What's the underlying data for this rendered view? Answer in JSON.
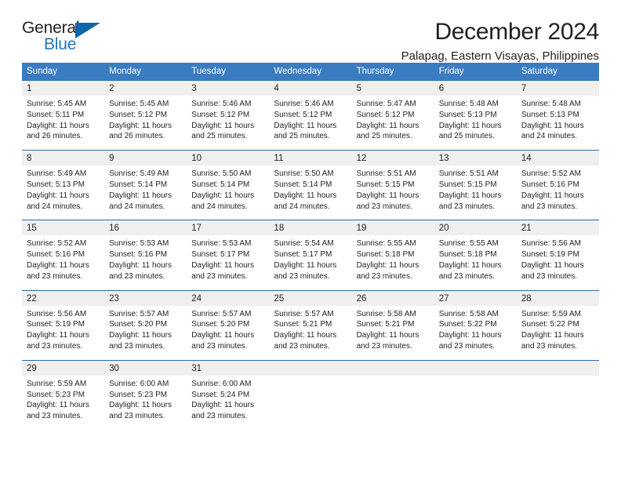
{
  "brand": {
    "name_top": "General",
    "name_bottom": "Blue",
    "accent_color": "#1064a8",
    "blue_text_color": "#1f77bd"
  },
  "header": {
    "title": "December 2024",
    "subtitle": "Palapag, Eastern Visayas, Philippines"
  },
  "theme": {
    "header_bar_color": "#3a7cc1",
    "row_rule_color": "#2f6cab",
    "daynum_band_color": "#efefef",
    "text_color": "#231f20"
  },
  "weekday_headers": [
    "Sunday",
    "Monday",
    "Tuesday",
    "Wednesday",
    "Thursday",
    "Friday",
    "Saturday"
  ],
  "weeks": [
    [
      {
        "day": "1",
        "sunrise": "Sunrise: 5:45 AM",
        "sunset": "Sunset: 5:11 PM",
        "daylight": "Daylight: 11 hours and 26 minutes."
      },
      {
        "day": "2",
        "sunrise": "Sunrise: 5:45 AM",
        "sunset": "Sunset: 5:12 PM",
        "daylight": "Daylight: 11 hours and 26 minutes."
      },
      {
        "day": "3",
        "sunrise": "Sunrise: 5:46 AM",
        "sunset": "Sunset: 5:12 PM",
        "daylight": "Daylight: 11 hours and 25 minutes."
      },
      {
        "day": "4",
        "sunrise": "Sunrise: 5:46 AM",
        "sunset": "Sunset: 5:12 PM",
        "daylight": "Daylight: 11 hours and 25 minutes."
      },
      {
        "day": "5",
        "sunrise": "Sunrise: 5:47 AM",
        "sunset": "Sunset: 5:12 PM",
        "daylight": "Daylight: 11 hours and 25 minutes."
      },
      {
        "day": "6",
        "sunrise": "Sunrise: 5:48 AM",
        "sunset": "Sunset: 5:13 PM",
        "daylight": "Daylight: 11 hours and 25 minutes."
      },
      {
        "day": "7",
        "sunrise": "Sunrise: 5:48 AM",
        "sunset": "Sunset: 5:13 PM",
        "daylight": "Daylight: 11 hours and 24 minutes."
      }
    ],
    [
      {
        "day": "8",
        "sunrise": "Sunrise: 5:49 AM",
        "sunset": "Sunset: 5:13 PM",
        "daylight": "Daylight: 11 hours and 24 minutes."
      },
      {
        "day": "9",
        "sunrise": "Sunrise: 5:49 AM",
        "sunset": "Sunset: 5:14 PM",
        "daylight": "Daylight: 11 hours and 24 minutes."
      },
      {
        "day": "10",
        "sunrise": "Sunrise: 5:50 AM",
        "sunset": "Sunset: 5:14 PM",
        "daylight": "Daylight: 11 hours and 24 minutes."
      },
      {
        "day": "11",
        "sunrise": "Sunrise: 5:50 AM",
        "sunset": "Sunset: 5:14 PM",
        "daylight": "Daylight: 11 hours and 24 minutes."
      },
      {
        "day": "12",
        "sunrise": "Sunrise: 5:51 AM",
        "sunset": "Sunset: 5:15 PM",
        "daylight": "Daylight: 11 hours and 23 minutes."
      },
      {
        "day": "13",
        "sunrise": "Sunrise: 5:51 AM",
        "sunset": "Sunset: 5:15 PM",
        "daylight": "Daylight: 11 hours and 23 minutes."
      },
      {
        "day": "14",
        "sunrise": "Sunrise: 5:52 AM",
        "sunset": "Sunset: 5:16 PM",
        "daylight": "Daylight: 11 hours and 23 minutes."
      }
    ],
    [
      {
        "day": "15",
        "sunrise": "Sunrise: 5:52 AM",
        "sunset": "Sunset: 5:16 PM",
        "daylight": "Daylight: 11 hours and 23 minutes."
      },
      {
        "day": "16",
        "sunrise": "Sunrise: 5:53 AM",
        "sunset": "Sunset: 5:16 PM",
        "daylight": "Daylight: 11 hours and 23 minutes."
      },
      {
        "day": "17",
        "sunrise": "Sunrise: 5:53 AM",
        "sunset": "Sunset: 5:17 PM",
        "daylight": "Daylight: 11 hours and 23 minutes."
      },
      {
        "day": "18",
        "sunrise": "Sunrise: 5:54 AM",
        "sunset": "Sunset: 5:17 PM",
        "daylight": "Daylight: 11 hours and 23 minutes."
      },
      {
        "day": "19",
        "sunrise": "Sunrise: 5:55 AM",
        "sunset": "Sunset: 5:18 PM",
        "daylight": "Daylight: 11 hours and 23 minutes."
      },
      {
        "day": "20",
        "sunrise": "Sunrise: 5:55 AM",
        "sunset": "Sunset: 5:18 PM",
        "daylight": "Daylight: 11 hours and 23 minutes."
      },
      {
        "day": "21",
        "sunrise": "Sunrise: 5:56 AM",
        "sunset": "Sunset: 5:19 PM",
        "daylight": "Daylight: 11 hours and 23 minutes."
      }
    ],
    [
      {
        "day": "22",
        "sunrise": "Sunrise: 5:56 AM",
        "sunset": "Sunset: 5:19 PM",
        "daylight": "Daylight: 11 hours and 23 minutes."
      },
      {
        "day": "23",
        "sunrise": "Sunrise: 5:57 AM",
        "sunset": "Sunset: 5:20 PM",
        "daylight": "Daylight: 11 hours and 23 minutes."
      },
      {
        "day": "24",
        "sunrise": "Sunrise: 5:57 AM",
        "sunset": "Sunset: 5:20 PM",
        "daylight": "Daylight: 11 hours and 23 minutes."
      },
      {
        "day": "25",
        "sunrise": "Sunrise: 5:57 AM",
        "sunset": "Sunset: 5:21 PM",
        "daylight": "Daylight: 11 hours and 23 minutes."
      },
      {
        "day": "26",
        "sunrise": "Sunrise: 5:58 AM",
        "sunset": "Sunset: 5:21 PM",
        "daylight": "Daylight: 11 hours and 23 minutes."
      },
      {
        "day": "27",
        "sunrise": "Sunrise: 5:58 AM",
        "sunset": "Sunset: 5:22 PM",
        "daylight": "Daylight: 11 hours and 23 minutes."
      },
      {
        "day": "28",
        "sunrise": "Sunrise: 5:59 AM",
        "sunset": "Sunset: 5:22 PM",
        "daylight": "Daylight: 11 hours and 23 minutes."
      }
    ],
    [
      {
        "day": "29",
        "sunrise": "Sunrise: 5:59 AM",
        "sunset": "Sunset: 5:23 PM",
        "daylight": "Daylight: 11 hours and 23 minutes."
      },
      {
        "day": "30",
        "sunrise": "Sunrise: 6:00 AM",
        "sunset": "Sunset: 5:23 PM",
        "daylight": "Daylight: 11 hours and 23 minutes."
      },
      {
        "day": "31",
        "sunrise": "Sunrise: 6:00 AM",
        "sunset": "Sunset: 5:24 PM",
        "daylight": "Daylight: 11 hours and 23 minutes."
      },
      {
        "day": "",
        "sunrise": "",
        "sunset": "",
        "daylight": ""
      },
      {
        "day": "",
        "sunrise": "",
        "sunset": "",
        "daylight": ""
      },
      {
        "day": "",
        "sunrise": "",
        "sunset": "",
        "daylight": ""
      },
      {
        "day": "",
        "sunrise": "",
        "sunset": "",
        "daylight": ""
      }
    ]
  ]
}
